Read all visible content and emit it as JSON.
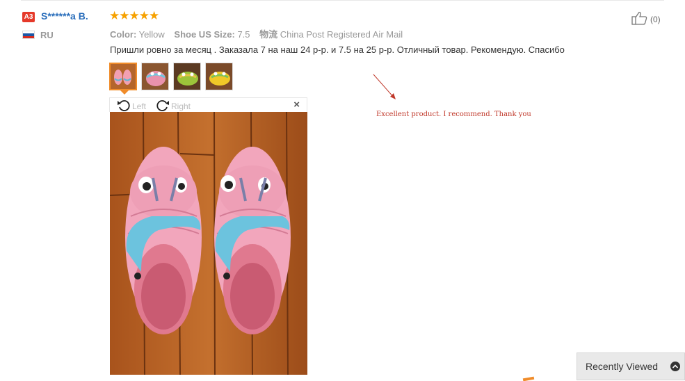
{
  "review": {
    "level_badge": "A3",
    "username": "S******a B.",
    "country": "RU",
    "rating_stars": "★★★★★",
    "rating_value": 5,
    "attributes": [
      {
        "label": "Color:",
        "value": "Yellow"
      },
      {
        "label": "Shoe US Size:",
        "value": "7.5"
      },
      {
        "label": "物流",
        "value": "China Post Registered Air Mail"
      }
    ],
    "text": "Пришли ровно за месяц . Заказала 7 на наш 24 р-р. и 7.5 на 25 р-р. Отличный товар. Рекомендую. Спасибо",
    "likes": "(0)"
  },
  "viewer": {
    "rotate_left_label": "Left",
    "rotate_right_label": "Right",
    "close_label": "×"
  },
  "annotation": {
    "text": "Excellent product. I recommend. Thank you",
    "color": "#c0392b"
  },
  "recently_viewed": {
    "label": "Recently Viewed"
  },
  "colors": {
    "badge": "#e5392a",
    "username": "#2a6ebb",
    "stars": "#f6a100",
    "active_thumb": "#f08c2a"
  },
  "icons": [
    "thumbs-up-icon",
    "rotate-left-icon",
    "rotate-right-icon",
    "close-icon",
    "chevron-up-icon",
    "russia-flag-icon"
  ]
}
